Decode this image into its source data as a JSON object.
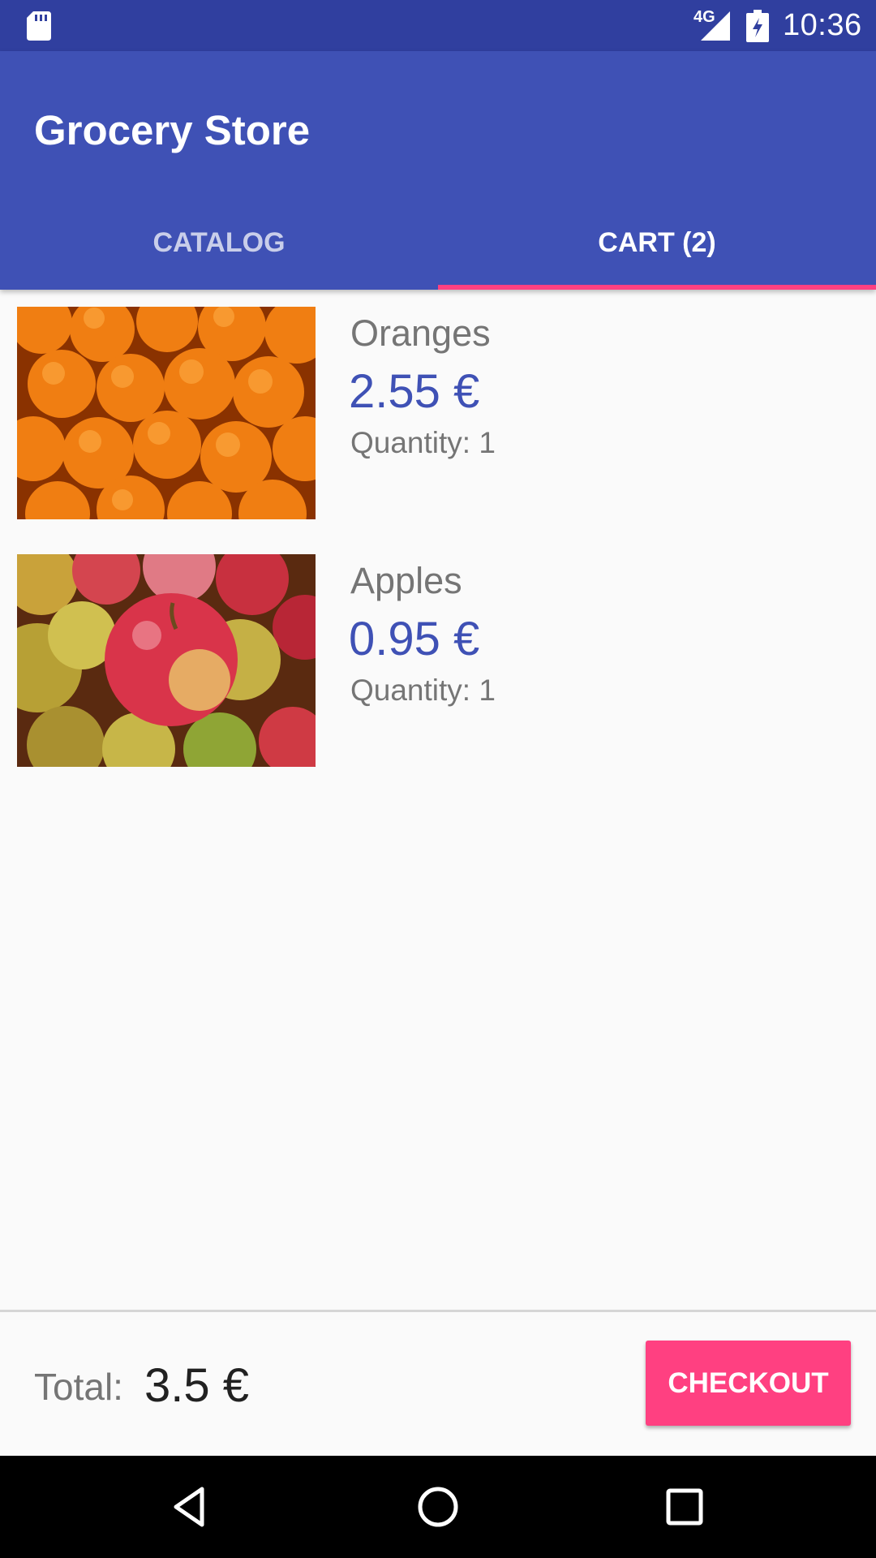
{
  "status_bar": {
    "time": "10:36",
    "network": "4G",
    "icons": [
      "sd-card-icon",
      "signal-icon",
      "battery-icon"
    ]
  },
  "app_bar": {
    "title": "Grocery Store"
  },
  "tabs": [
    {
      "label": "CATALOG",
      "active": false
    },
    {
      "label": "CART (2)",
      "active": true
    }
  ],
  "cart": {
    "items": [
      {
        "name": "Oranges",
        "price": "2.55 €",
        "quantity": "Quantity: 1",
        "image": "oranges-photo"
      },
      {
        "name": "Apples",
        "price": "0.95 €",
        "quantity": "Quantity: 1",
        "image": "apples-photo"
      }
    ]
  },
  "footer": {
    "total_label": "Total:",
    "total_value": "3.5 €",
    "checkout_label": "CHECKOUT"
  },
  "nav_bar": {
    "icons": [
      "back-icon",
      "home-icon",
      "recents-icon"
    ]
  },
  "colors": {
    "primary": "#3f51b5",
    "primary_dark": "#303f9f",
    "accent": "#ff4081"
  }
}
